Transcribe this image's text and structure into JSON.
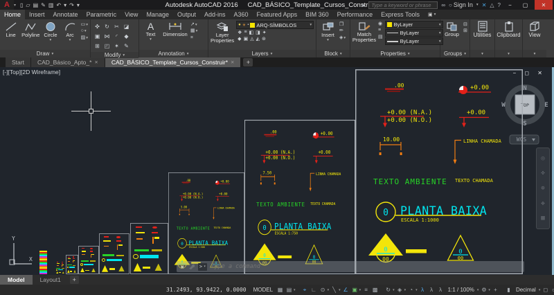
{
  "titlebar": {
    "app_title": "Autodesk AutoCAD 2016",
    "doc_title": "CAD_BÁSICO_Template_Cursos_Construir.dwg",
    "search_placeholder": "Type a keyword or phrase",
    "signin": "Sign In"
  },
  "icons": {
    "logo": "A",
    "caret": "▾",
    "expand": "▸",
    "qat": [
      "▯",
      "▱",
      "▤",
      "✎",
      "▥",
      "↶",
      "↷"
    ],
    "search": "∞",
    "signin": "○",
    "exchange": "✕",
    "a360": "△",
    "help": "?",
    "win_min": "−",
    "win_restore": "▢",
    "win_close": "✕",
    "ribbon_toggle": "▣",
    "draw_small": [
      "▭",
      "○",
      "▨"
    ],
    "modify": [
      "✜",
      "↻",
      "✂",
      "◪",
      "▣",
      "⋈",
      "◜",
      "◆",
      "⊞",
      "◰",
      "✶",
      "✎"
    ],
    "annotation_small": [
      "↗",
      "▦",
      "⌗"
    ],
    "layers_dd": [
      "●",
      "☀",
      "▪"
    ],
    "layers_row1": [
      "❖",
      "≡",
      "◧",
      "◨",
      "✦"
    ],
    "layers_row2": [
      "◆",
      "▣",
      "◬",
      "◭",
      "⊛"
    ],
    "block_small": [
      "❐",
      "✏",
      "◈"
    ],
    "prop_small": [
      "◉",
      "≡",
      "▤"
    ],
    "groups_small": [
      "⊟",
      "⊞"
    ],
    "navbar": [
      "◎",
      "✜",
      "⊕",
      "✥",
      "▦"
    ],
    "cmd_close": "✕",
    "cmd_prompt": ">"
  },
  "ribbon_tabs": [
    "Home",
    "Insert",
    "Annotate",
    "Parametric",
    "View",
    "Manage",
    "Output",
    "Add-ins",
    "A360",
    "Featured Apps",
    "BIM 360",
    "Performance",
    "Express Tools"
  ],
  "panels": {
    "draw": {
      "label": "Draw",
      "tools": [
        "Line",
        "Polyline",
        "Circle",
        "Arc"
      ]
    },
    "modify": {
      "label": "Modify"
    },
    "annotation": {
      "label": "Annotation",
      "text": "Text",
      "dimension": "Dimension"
    },
    "layers": {
      "label": "Layers",
      "layer_properties": "Layer Properties",
      "current_layer": "ARQ-SÍMBOLOS"
    },
    "block": {
      "label": "Block",
      "insert": "Insert"
    },
    "properties": {
      "label": "Properties",
      "match": "Match Properties",
      "bylayer": "ByLayer"
    },
    "groups": {
      "label": "Groups",
      "group": "Group"
    },
    "utilities": {
      "label": "Utilities"
    },
    "clipboard": {
      "label": "Clipboard"
    },
    "view": {
      "label": "View"
    }
  },
  "filetabs": [
    "Start",
    "CAD_Básico_Apto_*",
    "CAD_BÁSICO_Template_Cursos_Construir*"
  ],
  "viewport": {
    "label": "[-][Top][2D Wireframe]",
    "cube": {
      "n": "N",
      "w": "W",
      "e": "E",
      "s": "S",
      "top": "TOP",
      "wcs": "WCS"
    },
    "ucs": {
      "x": "X",
      "y": "Y"
    }
  },
  "drawing": {
    "shared": {
      "spot": ".00",
      "level": "+0.00",
      "level_na": "+0.00 (N.A.)",
      "level_no": "+0.00 (N.O.)",
      "leader": "LINHA CHAMADA",
      "ambient": "TEXTO AMBIENTE",
      "callout": "TEXTO CHAMADA",
      "title": "PLANTA BAIXA",
      "num": "0",
      "den": "00"
    },
    "frames": [
      {
        "dim": "10.00",
        "escala": "ESCALA 1:1000"
      },
      {
        "dim": "7.50",
        "escala": "ESCALA 1:750"
      },
      {
        "dim": "5.00",
        "escala": "ESCALA 1:500"
      }
    ]
  },
  "commandline": {
    "placeholder": "Type a command"
  },
  "model_tabs": {
    "model": "Model",
    "layout1": "Layout1"
  },
  "statusbar": {
    "coords": "31.2493, 93.9422, 0.0000",
    "space": "MODEL",
    "anno_scale": "1:1 / 100%",
    "units": "Decimal",
    "icons": [
      "▦",
      "▤",
      "⌖",
      "∟",
      "⊙",
      "╲",
      "∠",
      "▣",
      "≡",
      "▩",
      "↻",
      "◈",
      "◔",
      "λ",
      "λ",
      "λ",
      "⚙",
      "+",
      "▮",
      "◻",
      "▭",
      "✄",
      "●",
      "▤",
      "▥",
      "⊡",
      "≡"
    ]
  },
  "colors": {
    "yellow": "#f2e50a",
    "red": "#e32119",
    "green": "#27d427",
    "cyan": "#00e5ee",
    "orange": "#f07d12",
    "accent_blue": "#56a8e8",
    "close_red": "#c13328",
    "canvas_bg": "#20252c"
  }
}
